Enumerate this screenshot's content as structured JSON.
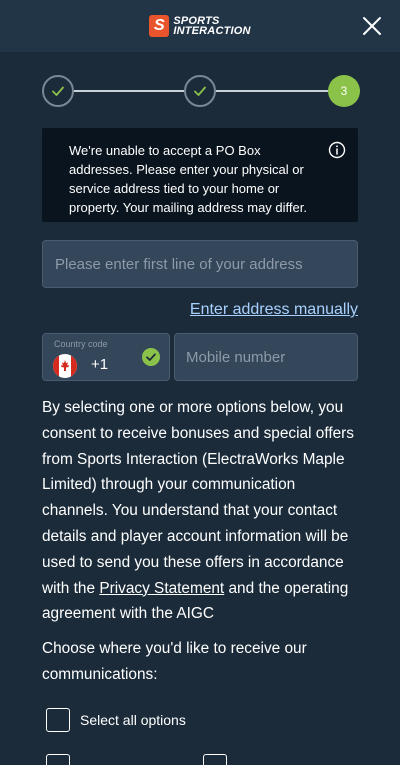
{
  "header": {
    "logo_line1": "Sports",
    "logo_line2": "Interaction",
    "logo_mark": "S",
    "close_icon": "close-icon"
  },
  "stepper": {
    "steps": [
      {
        "state": "done",
        "icon": "check-icon"
      },
      {
        "state": "done",
        "icon": "check-icon"
      },
      {
        "state": "active",
        "label": "3"
      }
    ],
    "colors": {
      "active": "#8bc34a",
      "done_border": "#7a8896"
    }
  },
  "notice": {
    "text": "We're unable to accept a PO Box addresses. Please enter your physical or service address tied to your home or property. Your mailing address may differ.",
    "icon": "info-icon"
  },
  "address": {
    "placeholder": "Please enter first line of your address",
    "manual_link": "Enter address manually"
  },
  "phone": {
    "country_label": "Country code",
    "dial_code": "+1",
    "flag_icon": "canada-flag-icon",
    "valid_icon": "check-circle-icon",
    "placeholder": "Mobile number"
  },
  "consent": {
    "text_before": "By selecting one or more options below, you consent to receive bonuses and special offers from Sports Interaction (ElectraWorks Maple Limited) through your communication channels. You understand that your contact details and player account information will be used to send you these offers in accordance with the ",
    "privacy_link": "Privacy Statement",
    "text_after": " and the operating agreement with the AIGC"
  },
  "communications": {
    "prompt": "Choose where you'd like to receive our communications:",
    "select_all_label": "Select all options"
  },
  "colors": {
    "background": "#1b2b3a",
    "header": "#223547",
    "notice": "#0a141e",
    "input": "#34465a",
    "link": "#a9d1ff",
    "brand": "#e8542c"
  }
}
